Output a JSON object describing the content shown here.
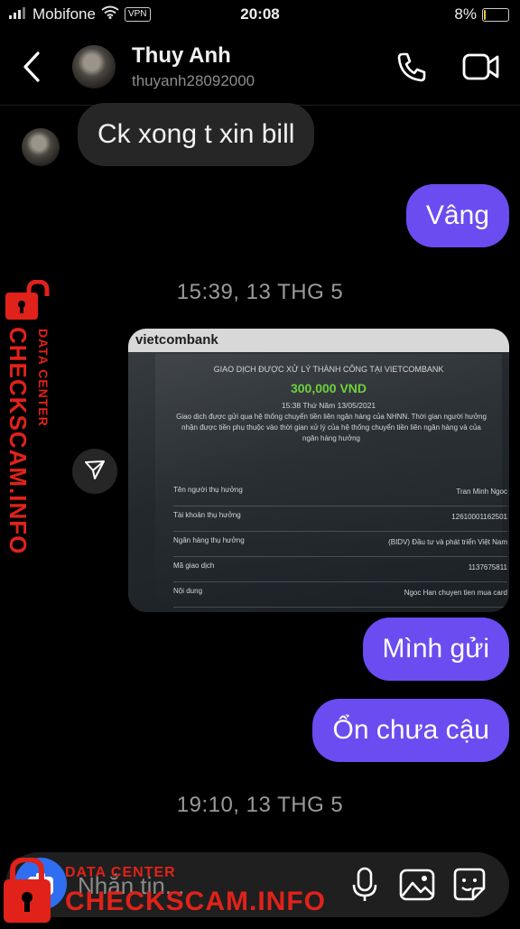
{
  "status_bar": {
    "carrier": "Mobifone",
    "vpn": "VPN",
    "time": "20:08",
    "battery": "8%",
    "battery_level": 0.08
  },
  "header": {
    "name": "Thuy Anh",
    "handle": "thuyanh28092000"
  },
  "messages": [
    {
      "text": "Ck xong t xin bill"
    },
    {
      "text": "Vâng"
    },
    {
      "timestamp": "15:39, 13 THG 5"
    },
    {
      "text": "Mình gửi"
    },
    {
      "text": "Ổn chưa cậu"
    },
    {
      "timestamp": "19:10, 13 THG 5"
    }
  ],
  "receipt": {
    "bank_logo": "vietcombank",
    "heading": "GIAO DỊCH ĐƯỢC XỬ LÝ THÀNH CÔNG TẠI VIETCOMBANK",
    "amount": "300,000 VND",
    "datetime": "15:38 Thứ Năm 13/05/2021",
    "note": "Giao dịch được gửi qua hệ thống chuyển tiền liên ngân hàng của NHNN. Thời gian người hưởng nhận được tiền phụ thuộc vào thời gian xử lý của hệ thống chuyển tiền liên ngân hàng và của ngân hàng hưởng",
    "rows": [
      {
        "label": "Tên người thụ hưởng",
        "value": "Tran Minh Ngoc"
      },
      {
        "label": "Tài khoản thụ hưởng",
        "value": "12610001162501"
      },
      {
        "label": "Ngân hàng thụ hưởng",
        "value": "(BIDV) Đầu tư và phát triển Việt Nam"
      },
      {
        "label": "Mã giao dịch",
        "value": "1137675811"
      },
      {
        "label": "Nội dung",
        "value": "Ngoc Han chuyen tien mua card"
      }
    ]
  },
  "composer": {
    "placeholder": "Nhắn tin..."
  },
  "watermark": {
    "line1": "DATA CENTER",
    "line2": "CHECKSCAM.INFO"
  },
  "colors": {
    "sent_bubble": "#6a4cf0",
    "received_bubble": "#262626",
    "amount_green": "#6ed13d",
    "watermark_red": "#e0221a"
  }
}
